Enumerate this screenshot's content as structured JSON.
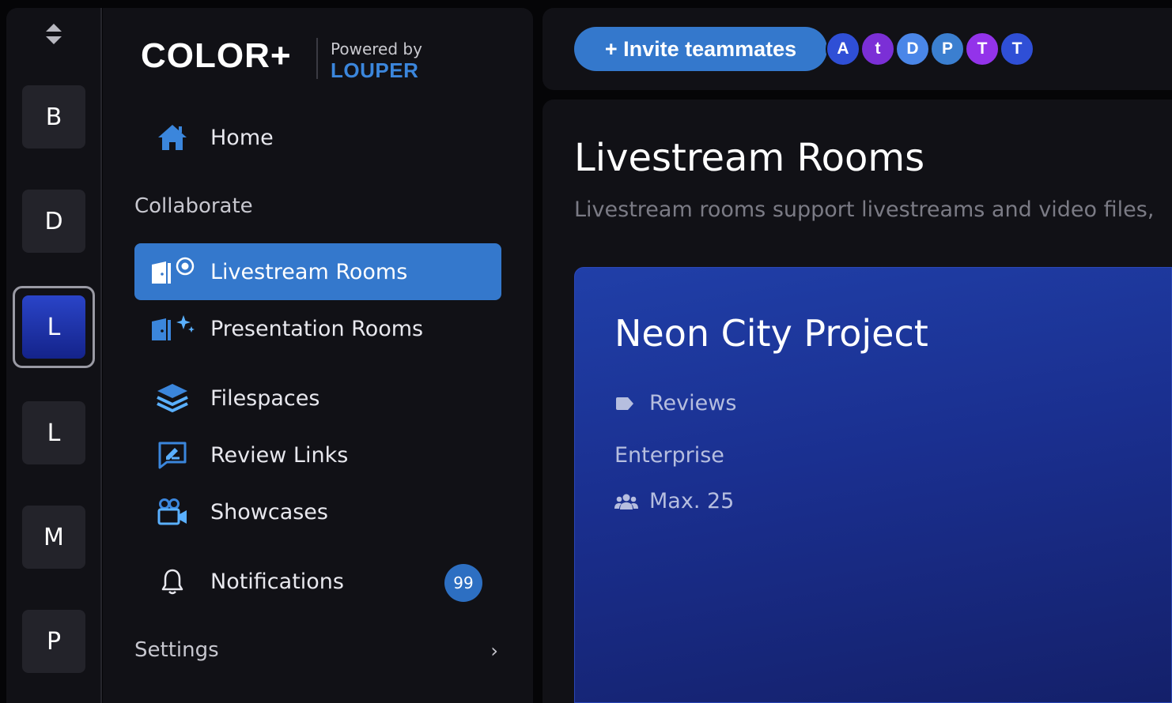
{
  "workspaces": [
    {
      "letter": "B"
    },
    {
      "letter": "D"
    },
    {
      "letter": "L",
      "active": true
    },
    {
      "letter": "L"
    },
    {
      "letter": "M"
    },
    {
      "letter": "P"
    }
  ],
  "brand": {
    "logo": "COLOR+",
    "powered_by": "Powered by",
    "partner": "LOUPER"
  },
  "nav": {
    "home": "Home",
    "collaborate_label": "Collaborate",
    "livestream_rooms": "Livestream Rooms",
    "presentation_rooms": "Presentation Rooms",
    "filespaces": "Filespaces",
    "review_links": "Review Links",
    "showcases": "Showcases",
    "notifications": "Notifications",
    "notifications_count": "99",
    "settings": "Settings"
  },
  "topbar": {
    "invite_label": "+ Invite teammates",
    "avatars": [
      {
        "initial": "A",
        "color": "#2f4fd6"
      },
      {
        "initial": "t",
        "color": "#7b2fd6"
      },
      {
        "initial": "D",
        "color": "#4a86e8"
      },
      {
        "initial": "P",
        "color": "#3b7fd0"
      },
      {
        "initial": "T",
        "color": "#9333ea"
      },
      {
        "initial": "T",
        "color": "#2f4fd6"
      }
    ]
  },
  "main": {
    "title": "Livestream Rooms",
    "subtitle": "Livestream rooms support livestreams and video files,"
  },
  "card": {
    "title": "Neon City Project",
    "tag": "Reviews",
    "plan": "Enterprise",
    "capacity": "Max. 25"
  },
  "colors": {
    "accent": "#3478cc",
    "panel": "#111116",
    "background": "#050507"
  }
}
